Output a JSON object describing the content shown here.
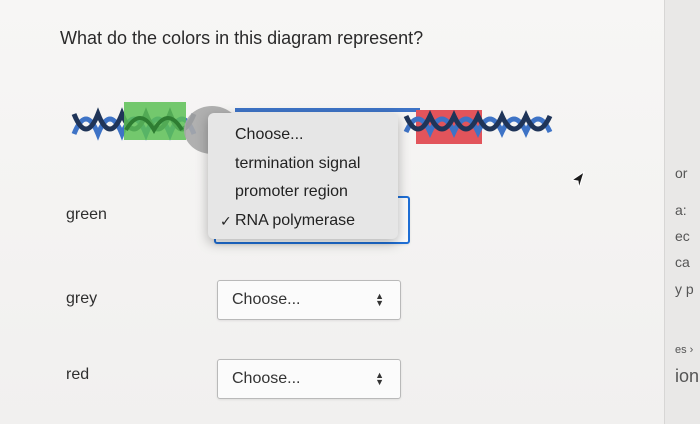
{
  "question": "What do the colors in this diagram represent?",
  "rows": [
    {
      "label": "green",
      "select_value": ""
    },
    {
      "label": "grey",
      "select_value": "Choose..."
    },
    {
      "label": "red",
      "select_value": "Choose..."
    }
  ],
  "dropdown": {
    "options": [
      "Choose...",
      "termination signal",
      "promoter region",
      "RNA polymerase"
    ],
    "checked_index": 3,
    "checkmark": "✓"
  },
  "select_arrows": {
    "up": "▲",
    "down": "▼"
  },
  "diagram_colors": {
    "green": "#5cbf55",
    "grey": "#a9a9a9",
    "red": "#e2545b",
    "strand_blue": "#3e73c6",
    "strand_dark": "#1f3458"
  },
  "right_strip_fragments": [
    "or",
    "a:",
    "ec",
    "ca",
    "y p",
    "es ›",
    "ion"
  ]
}
